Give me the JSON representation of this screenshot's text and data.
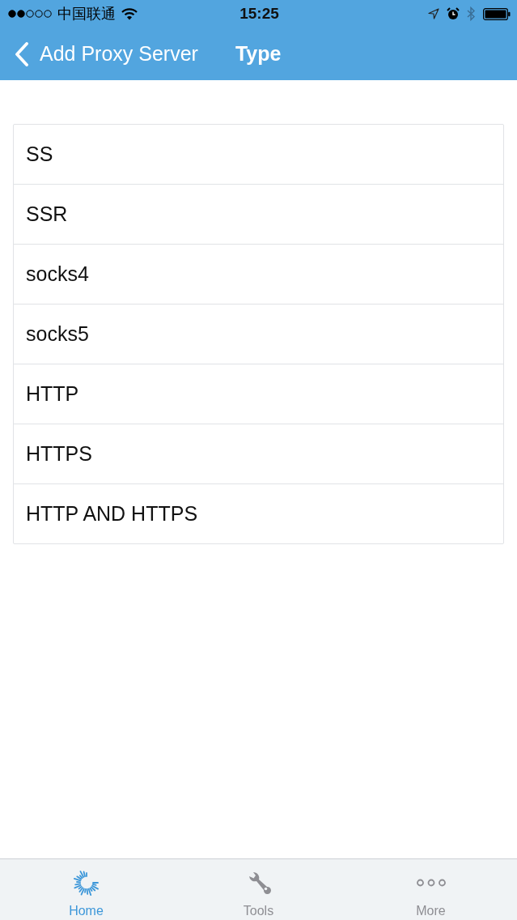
{
  "status_bar": {
    "carrier": "中国联通",
    "time": "15:25"
  },
  "nav_bar": {
    "back_label": "Add Proxy Server",
    "title": "Type"
  },
  "type_list": {
    "items": [
      {
        "label": "SS"
      },
      {
        "label": "SSR"
      },
      {
        "label": "socks4"
      },
      {
        "label": "socks5"
      },
      {
        "label": "HTTP"
      },
      {
        "label": "HTTPS"
      },
      {
        "label": "HTTP AND HTTPS"
      }
    ]
  },
  "tab_bar": {
    "tabs": [
      {
        "kind": "home",
        "label": "Home",
        "selected": true
      },
      {
        "kind": "tools",
        "label": "Tools",
        "selected": false
      },
      {
        "kind": "more",
        "label": "More",
        "selected": false
      }
    ]
  }
}
